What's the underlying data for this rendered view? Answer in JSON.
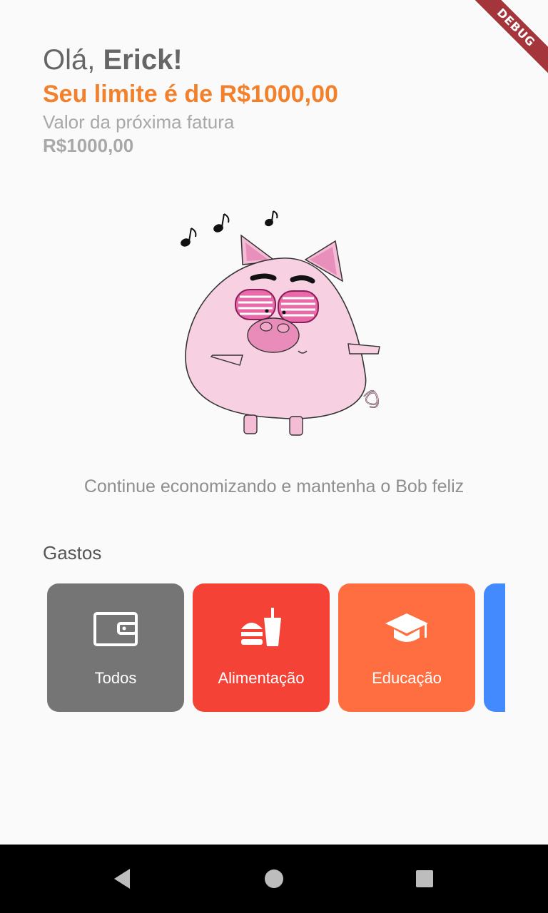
{
  "debug_banner": "DEBUG",
  "header": {
    "greeting_prefix": "Olá, ",
    "user_name": "Erick!",
    "limit_text": "Seu limite é de R$1000,00",
    "invoice_label": "Valor da próxima fatura",
    "invoice_value": "R$1000,00"
  },
  "mascot": {
    "name": "Bob",
    "icon": "dancing-pig-illustration"
  },
  "message": "Continue economizando e mantenha o Bob feliz",
  "section_title": "Gastos",
  "categories": [
    {
      "label": "Todos",
      "icon": "wallet-icon",
      "color": "#757575"
    },
    {
      "label": "Alimentação",
      "icon": "fast-food-icon",
      "color": "#f44336"
    },
    {
      "label": "Educação",
      "icon": "graduation-cap-icon",
      "color": "#ff6e40"
    },
    {
      "label": "",
      "icon": "",
      "color": "#448aff"
    }
  ],
  "colors": {
    "accent": "#f3802a",
    "background": "#fafafa"
  },
  "navbar": {
    "back_icon": "back-triangle-icon",
    "home_icon": "home-circle-icon",
    "recents_icon": "recents-square-icon"
  }
}
